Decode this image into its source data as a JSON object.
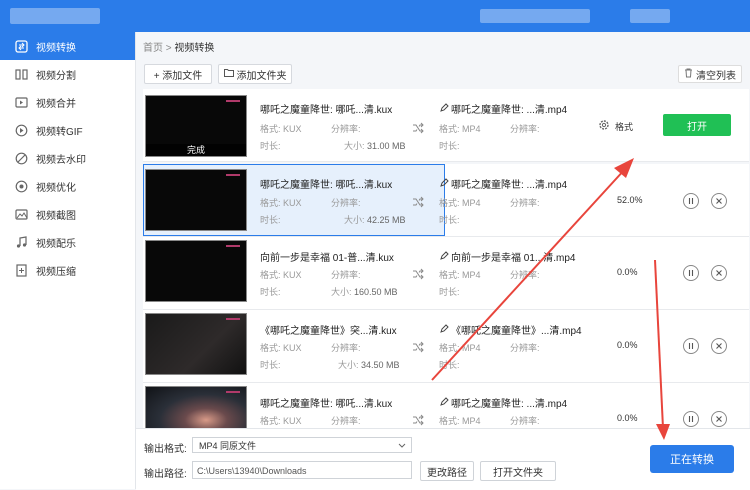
{
  "sidebar": {
    "items": [
      {
        "label": "视频转换",
        "icon": "convert-icon",
        "active": true
      },
      {
        "label": "视频分割",
        "icon": "split-icon"
      },
      {
        "label": "视频合并",
        "icon": "merge-icon"
      },
      {
        "label": "视频转GIF",
        "icon": "gif-icon"
      },
      {
        "label": "视频去水印",
        "icon": "watermark-icon"
      },
      {
        "label": "视频优化",
        "icon": "optimize-icon"
      },
      {
        "label": "视频截图",
        "icon": "screenshot-icon"
      },
      {
        "label": "视频配乐",
        "icon": "music-icon"
      },
      {
        "label": "视频压缩",
        "icon": "compress-icon"
      }
    ]
  },
  "breadcrumb": {
    "home": "首页",
    "separator": ">",
    "current": "视频转换"
  },
  "toolbar": {
    "add_file": "+ 添加文件",
    "add_folder": "添加文件夹",
    "clear_list": "清空列表"
  },
  "labels": {
    "format": "格式:",
    "resolution": "分辨率:",
    "duration": "时长:",
    "size": "大小:"
  },
  "files": [
    {
      "src_name": "哪吒之魔童降世: 哪吒...清.kux",
      "src_format": "KUX",
      "size": "31.00 MB",
      "dst_name": "哪吒之魔童降世: ...清.mp4",
      "dst_format": "MP4",
      "status": "done",
      "done_label": "完成",
      "format_label": "格式",
      "open_label": "打开",
      "thumb": "black"
    },
    {
      "src_name": "哪吒之魔童降世: 哪吒...清.kux",
      "src_format": "KUX",
      "size": "42.25 MB",
      "dst_name": "哪吒之魔童降世: ...清.mp4",
      "dst_format": "MP4",
      "progress": "52.0%",
      "thumb": "black"
    },
    {
      "src_name": "向前一步是幸福 01-普...清.kux",
      "src_format": "KUX",
      "size": "160.50 MB",
      "dst_name": "向前一步是幸福 01...清.mp4",
      "dst_format": "MP4",
      "progress": "0.0%",
      "thumb": "black"
    },
    {
      "src_name": "《哪吒之魔童降世》突...清.kux",
      "src_format": "KUX",
      "size": "34.50 MB",
      "dst_name": "《哪吒之魔童降世》...清.mp4",
      "dst_format": "MP4",
      "progress": "0.0%",
      "thumb": "dark"
    },
    {
      "src_name": "哪吒之魔童降世: 哪吒...清.kux",
      "src_format": "KUX",
      "size": "",
      "dst_name": "哪吒之魔童降世: ...清.mp4",
      "dst_format": "MP4",
      "progress": "0.0%",
      "thumb": "smoke"
    }
  ],
  "bottom": {
    "output_format_label": "输出格式:",
    "output_format_value": "MP4  同原文件",
    "output_path_label": "输出路径:",
    "output_path_value": "C:\\Users\\13940\\Downloads",
    "change_path": "更改路径",
    "open_folder": "打开文件夹",
    "convert_button": "正在转换"
  },
  "colors": {
    "accent": "#2b7ce9",
    "open_green": "#20c055",
    "annotation_red": "#e8453c"
  }
}
